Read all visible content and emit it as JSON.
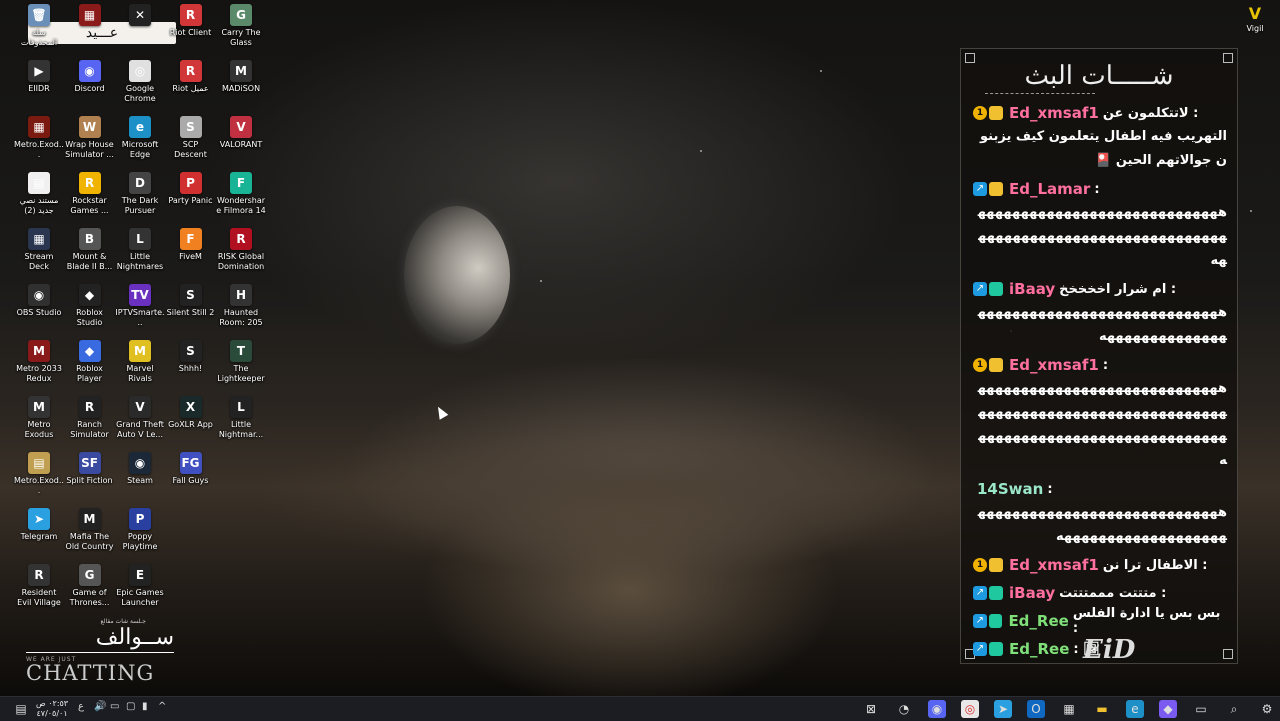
{
  "desktop": {
    "icons": [
      {
        "label": "سلة المحذوفات",
        "color": "#6a8fb8",
        "glyph": "🗑"
      },
      {
        "label": "",
        "color": "#8b1a1a",
        "glyph": "▦"
      },
      {
        "label": "",
        "color": "#222",
        "glyph": "✕"
      },
      {
        "label": "Riot Client",
        "color": "#d13639",
        "glyph": "R"
      },
      {
        "label": "Carry The Glass",
        "color": "#5a8a6a",
        "glyph": "G"
      },
      {
        "label": "EIIDR",
        "color": "#333",
        "glyph": "▶"
      },
      {
        "label": "Discord",
        "color": "#5865f2",
        "glyph": "◉"
      },
      {
        "label": "Google Chrome",
        "color": "#e0e0e0",
        "glyph": "◎"
      },
      {
        "label": "Riot عميل",
        "color": "#d13639",
        "glyph": "R"
      },
      {
        "label": "MADiSON",
        "color": "#333",
        "glyph": "M"
      },
      {
        "label": "Metro.Exod...",
        "color": "#7a1a10",
        "glyph": "▦"
      },
      {
        "label": "Wrap House Simulator ...",
        "color": "#b08050",
        "glyph": "W"
      },
      {
        "label": "Microsoft Edge",
        "color": "#1e90c8",
        "glyph": "e"
      },
      {
        "label": "SCP Descent",
        "color": "#aaa",
        "glyph": "S"
      },
      {
        "label": "VALORANT",
        "color": "#c03040",
        "glyph": "V"
      },
      {
        "label": "مستند نصي جديد (2)",
        "color": "#f0f0f0",
        "glyph": "▤"
      },
      {
        "label": "Rockstar Games ...",
        "color": "#f0b400",
        "glyph": "R"
      },
      {
        "label": "The Dark Pursuer",
        "color": "#444",
        "glyph": "D"
      },
      {
        "label": "Party Panic",
        "color": "#d03030",
        "glyph": "P"
      },
      {
        "label": "Wondershare Filmora 14",
        "color": "#19b395",
        "glyph": "F"
      },
      {
        "label": "Stream Deck",
        "color": "#2a3550",
        "glyph": "▦"
      },
      {
        "label": "Mount & Blade II B...",
        "color": "#555",
        "glyph": "B"
      },
      {
        "label": "Little Nightmares",
        "color": "#333",
        "glyph": "L"
      },
      {
        "label": "FiveM",
        "color": "#f08020",
        "glyph": "F"
      },
      {
        "label": "RISK Global Domination",
        "color": "#b01020",
        "glyph": "R"
      },
      {
        "label": "OBS Studio",
        "color": "#303030",
        "glyph": "◉"
      },
      {
        "label": "Roblox Studio",
        "color": "#222",
        "glyph": "◆"
      },
      {
        "label": "IPTVSmarte...",
        "color": "#6a30c0",
        "glyph": "TV"
      },
      {
        "label": "Silent Still 2",
        "color": "#222",
        "glyph": "S"
      },
      {
        "label": "Haunted Room: 205",
        "color": "#333",
        "glyph": "H"
      },
      {
        "label": "Metro 2033 Redux",
        "color": "#8a1a1a",
        "glyph": "M"
      },
      {
        "label": "Roblox Player",
        "color": "#3a6ae0",
        "glyph": "◆"
      },
      {
        "label": "Marvel Rivals",
        "color": "#e0c020",
        "glyph": "M"
      },
      {
        "label": "Shhh!",
        "color": "#222",
        "glyph": "S"
      },
      {
        "label": "The Lightkeeper",
        "color": "#2a4a3a",
        "glyph": "T"
      },
      {
        "label": "Metro Exodus",
        "color": "#333",
        "glyph": "M"
      },
      {
        "label": "Ranch Simulator",
        "color": "#222",
        "glyph": "R"
      },
      {
        "label": "Grand Theft Auto V Le...",
        "color": "#2a2a2a",
        "glyph": "V"
      },
      {
        "label": "GoXLR App",
        "color": "#1a2a2a",
        "glyph": "X"
      },
      {
        "label": "Little Nightmar...",
        "color": "#222",
        "glyph": "L"
      },
      {
        "label": "Metro.Exod...",
        "color": "#c0a050",
        "glyph": "▤"
      },
      {
        "label": "Split Fiction",
        "color": "#3a4aa0",
        "glyph": "SF"
      },
      {
        "label": "Steam",
        "color": "#1b2838",
        "glyph": "◉"
      },
      {
        "label": "Fall Guys",
        "color": "#4050c0",
        "glyph": "FG"
      },
      {
        "label": "Telegram",
        "color": "#2aa0e0",
        "glyph": "➤"
      },
      {
        "label": "Mafia The Old Country",
        "color": "#222",
        "glyph": "M"
      },
      {
        "label": "Poppy Playtime",
        "color": "#2a40a0",
        "glyph": "P"
      },
      {
        "label": "Resident Evil Village",
        "color": "#333",
        "glyph": "R"
      },
      {
        "label": "Game of Thrones...",
        "color": "#555",
        "glyph": "G"
      },
      {
        "label": "Epic Games Launcher",
        "color": "#222",
        "glyph": "E"
      }
    ]
  },
  "banner": {
    "text": "عـــيد"
  },
  "overlay": {
    "sub": "جـلسة شات مقالع",
    "arabic": "ســوالف",
    "we_are": "WE ARE JUST",
    "chatting": "CHATTING"
  },
  "vigil": {
    "label": "Vigil"
  },
  "chat": {
    "title": "شـــــات البث",
    "messages": [
      {
        "user": "Ed_xmsaf1",
        "color": "#ff6fa0",
        "badges": [
          "coin",
          "crown"
        ],
        "inline": "لاتتكلمون عن :",
        "body": "التهريب فيه اطفال يتعلمون كيف يزبنون جوالاتهم الحين 🎴"
      },
      {
        "user": "Ed_Lamar",
        "color": "#ff6fa0",
        "badges": [
          "arrow",
          "crown"
        ],
        "inline": ":",
        "body": "هههههههههههههههههههههههههههههههههههههههههههههههههههههههههههه"
      },
      {
        "user": "iBaay",
        "color": "#ff6fa0",
        "badges": [
          "arrow",
          "bars"
        ],
        "inline": "ام شرار اخخخخخ :",
        "body": "هههههههههههههههههههههههههههههههههههههههههههه"
      },
      {
        "user": "Ed_xmsaf1",
        "color": "#ff6fa0",
        "badges": [
          "coin",
          "crown"
        ],
        "inline": ":",
        "body": "هههههههههههههههههههههههههههههههههههههههههههههههههههههههههههههههههههههههههههههههههههههههه"
      },
      {
        "user": "14Swan",
        "color": "#9be8c8",
        "badges": [],
        "inline": ":",
        "body": "ههههههههههههههههههههههههههههههههههههههههههههههههه"
      },
      {
        "user": "Ed_xmsaf1",
        "color": "#ff6fa0",
        "badges": [
          "coin",
          "crown"
        ],
        "inline": "الاطفال ترا نن :",
        "body": ""
      },
      {
        "user": "iBaay",
        "color": "#ff6fa0",
        "badges": [
          "arrow",
          "bars"
        ],
        "inline": "متتتت مممتتتت :",
        "body": ""
      },
      {
        "user": "Ed_Ree",
        "color": "#7fe07a",
        "badges": [
          "arrow",
          "bars"
        ],
        "inline": "بس بس يا ادارة الفلس :",
        "body": ""
      },
      {
        "user": "Ed_Ree",
        "color": "#7fe07a",
        "badges": [
          "arrow",
          "bars"
        ],
        "inline": ": 🖼",
        "body": ""
      }
    ],
    "logo": "EiD"
  },
  "taskbar": {
    "clock_time": "٠٢:٥٣ ص",
    "clock_date": "٤٧/٠٥/٠١",
    "lang": "ع"
  }
}
